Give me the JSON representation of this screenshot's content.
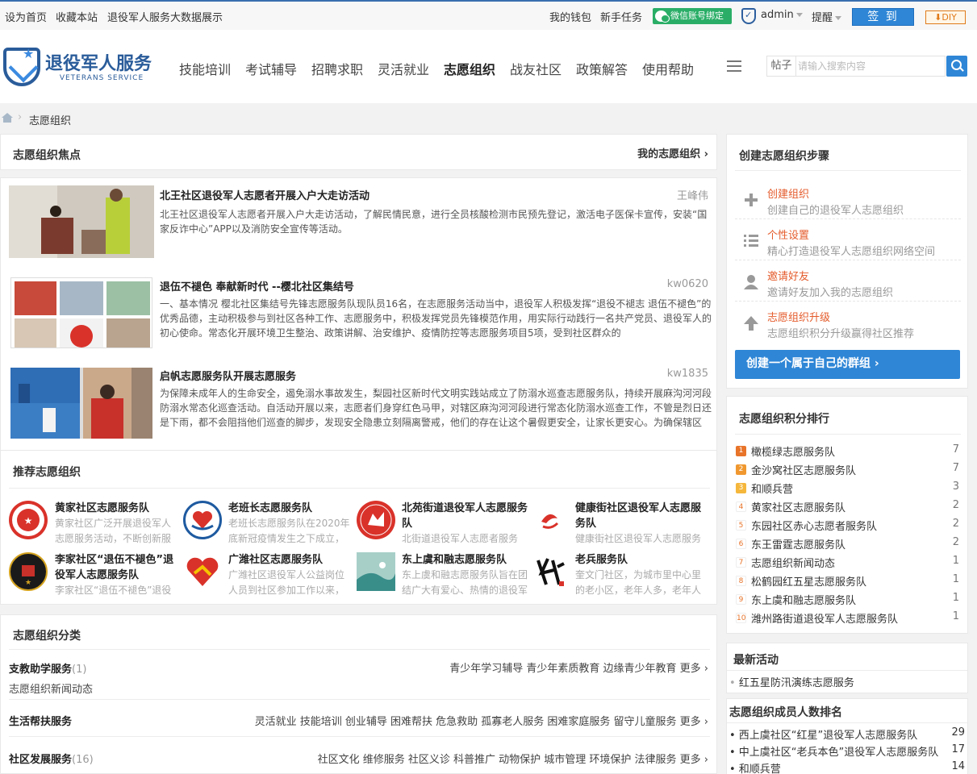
{
  "topbar": {
    "set_home": "设为首页",
    "bookmark": "收藏本站",
    "bigdata": "退役军人服务大数据展示",
    "wallet": "我的钱包",
    "newbie": "新手任务",
    "wechat_bind": "微信账号绑定",
    "username": "admin",
    "reminder": "提醒",
    "signin": "签 到",
    "diy": "DIY"
  },
  "logo": {
    "cn": "退役军人服务",
    "en": "VETERANS SERVICE"
  },
  "nav": [
    "技能培训",
    "考试辅导",
    "招聘求职",
    "灵活就业",
    "志愿组织",
    "战友社区",
    "政策解答",
    "使用帮助"
  ],
  "nav_active": "志愿组织",
  "search": {
    "type": "帖子",
    "placeholder": "请输入搜索内容"
  },
  "breadcrumb": "志愿组织",
  "focus": {
    "title": "志愿组织焦点",
    "my_link": "我的志愿组织 ›",
    "articles": [
      {
        "title": "北王社区退役军人志愿者开展入户大走访活动",
        "author": "王峰伟",
        "body": "北王社区退役军人志愿者开展入户大走访活动，了解民情民意，进行全员核酸检测市民预先登记，激活电子医保卡宣传，安装“国家反诈中心”APP以及消防安全宣传等活动。"
      },
      {
        "title": "退伍不褪色 奉献新时代 --樱北社区集结号",
        "author": "kw0620",
        "body": "一、基本情况 樱北社区集结号先锋志愿服务队现队员16名，在志愿服务活动当中，退役军人积极发挥“退役不褪志 退伍不褪色”的优秀品德，主动积极参与到社区各种工作、志愿服务中，积极发挥党员先锋模范作用，用实际行动践行一名共产党员、退役军人的初心使命。常态化开展环境卫生整治、政策讲解、治安维护、疫情防控等志愿服务项目5项，受到社区群众的"
      },
      {
        "title": "启帆志愿服务队开展志愿服务",
        "author": "kw1835",
        "body": "为保障未成年人的生命安全，遏免溺水事故发生，梨园社区新时代文明实践站成立了防溺水巡查志愿服务队，持续开展麻沟河河段防溺水常态化巡查活动。自活动开展以来，志愿者们身穿红色马甲，对辖区麻沟河河段进行常态化防溺水巡查工作，不管是烈日还是下雨，都不会阻挡他们巡查的脚步，发现安全隐患立刻隔离警戒，他们的存在让这个暑假更安全，让家长更安心。为确保辖区"
      }
    ]
  },
  "recommend": {
    "title": "推荐志愿组织",
    "items": [
      {
        "name": "黄家社区志愿服务队",
        "desc": "黄家社区广泛开展退役军人志愿服务活动，不断创新服务载"
      },
      {
        "name": "老班长志愿服务队",
        "desc": "老班长志愿服务队在2020年底新冠疫情发生之下成立，由"
      },
      {
        "name": "北苑街道退役军人志愿服务队",
        "desc": "北街道退役军人志愿者服务"
      },
      {
        "name": "健康街社区退役军人志愿服务队",
        "desc": "健康街社区退役军人志愿服务"
      },
      {
        "name": "李家社区“退伍不褪色”退役军人志愿服务队",
        "desc": "李家社区“退伍不褪色”退役"
      },
      {
        "name": "广潍社区志愿服务队",
        "desc": "广潍社区退役军人公益岗位人员到社区参加工作以来，乐"
      },
      {
        "name": "东上虞和融志愿服务队",
        "desc": "东上虞和融志愿服务队旨在团结广大有爱心、热情的退役军"
      },
      {
        "name": "老兵服务队",
        "desc": "奎文门社区，为城市里中心里的老小区，老年人多，老年人"
      }
    ]
  },
  "category": {
    "title": "志愿组织分类",
    "rows": [
      {
        "name": "支教助学服务",
        "count": "(1)",
        "tags": "青少年学习辅导 青少年素质教育 边缘青少年教育 更多 ›",
        "sub": "志愿组织新闻动态"
      },
      {
        "name": "生活帮扶服务",
        "count": "",
        "tags": "灵活就业 技能培训 创业辅导 困难帮扶 危急救助 孤寡老人服务 困难家庭服务 留守儿童服务 更多 ›",
        "sub": ""
      },
      {
        "name": "社区发展服务",
        "count": "(16)",
        "tags": "社区文化 维修服务 社区义诊 科普推广 动物保护 城市管理 环境保护 法律服务 更多 ›",
        "sub": ""
      }
    ]
  },
  "steps": {
    "title": "创建志愿组织步骤",
    "items": [
      {
        "icon": "plus-icon",
        "title": "创建组织",
        "desc": "创建自己的退役军人志愿组织"
      },
      {
        "icon": "list-icon",
        "title": "个性设置",
        "desc": "精心打造退役军人志愿组织网络空间"
      },
      {
        "icon": "user-icon",
        "title": "邀请好友",
        "desc": "邀请好友加入我的志愿组织"
      },
      {
        "icon": "arrow-up-icon",
        "title": "志愿组织升级",
        "desc": "志愿组织积分升级赢得社区推荐"
      }
    ],
    "button": "创建一个属于自己的群组 ›"
  },
  "ranking": {
    "title": "志愿组织积分排行",
    "items": [
      {
        "rank": "1",
        "name": "橄榄绿志愿服务队",
        "score": "7"
      },
      {
        "rank": "2",
        "name": "金沙窝社区志愿服务队",
        "score": "7"
      },
      {
        "rank": "3",
        "name": "和顺兵营",
        "score": "3"
      },
      {
        "rank": "4",
        "name": "黄家社区志愿服务队",
        "score": "2"
      },
      {
        "rank": "5",
        "name": "东园社区赤心志愿者服务队",
        "score": "2"
      },
      {
        "rank": "6",
        "name": "东王雷霆志愿服务队",
        "score": "2"
      },
      {
        "rank": "7",
        "name": "志愿组织新闻动态",
        "score": "1"
      },
      {
        "rank": "8",
        "name": "松鹤园红五星志愿服务队",
        "score": "1"
      },
      {
        "rank": "9",
        "name": "东上虞和融志愿服务队",
        "score": "1"
      },
      {
        "rank": "10",
        "name": "潍州路街道退役军人志愿服务队",
        "score": "1"
      }
    ],
    "badge_colors": {
      "top1": "#e8742a",
      "top2": "#f0982f",
      "top3": "#f5b73c",
      "other_bg": "#fff",
      "other_fg": "#e8742a"
    }
  },
  "latest": {
    "title": "最新活动",
    "items": [
      "红五星防汛演练志愿服务"
    ]
  },
  "members": {
    "title": "志愿组织成员人数排名",
    "items": [
      {
        "name": "西上虞社区“红星”退役军人志愿服务队",
        "count": "29"
      },
      {
        "name": "中上虞社区“老兵本色”退役军人志愿服务队",
        "count": "17"
      },
      {
        "name": "和顺兵营",
        "count": "14"
      }
    ]
  },
  "colors": {
    "accent": "#2f86d6",
    "step_title": "#e45b2b",
    "wechat": "#2aae67",
    "brand": "#2a5c9a"
  }
}
